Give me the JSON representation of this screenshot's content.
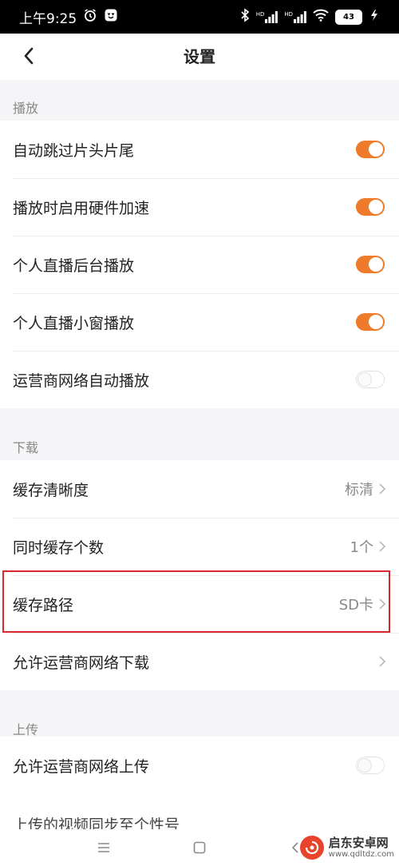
{
  "status_bar": {
    "time": "上午9:25",
    "network_1": "HD",
    "network_2": "HD",
    "battery": "43"
  },
  "header": {
    "title": "设置",
    "back_icon": "chevron-left-icon"
  },
  "sections": {
    "playback": {
      "title": "播放",
      "items": [
        {
          "label": "自动跳过片头片尾",
          "toggle": "on"
        },
        {
          "label": "播放时启用硬件加速",
          "toggle": "on"
        },
        {
          "label": "个人直播后台播放",
          "toggle": "on"
        },
        {
          "label": "个人直播小窗播放",
          "toggle": "on"
        },
        {
          "label": "运营商网络自动播放",
          "toggle": "off"
        }
      ]
    },
    "download": {
      "title": "下载",
      "items": [
        {
          "label": "缓存清晰度",
          "value": "标清"
        },
        {
          "label": "同时缓存个数",
          "value": "1个"
        },
        {
          "label": "缓存路径",
          "value": "SD卡"
        },
        {
          "label": "允许运营商网络下载",
          "value": ""
        }
      ]
    },
    "upload": {
      "title": "上传",
      "items": [
        {
          "label": "允许运营商网络上传",
          "toggle": "off"
        },
        {
          "label": "上传的视频同步至个性号"
        }
      ]
    }
  },
  "watermark": {
    "name": "启东安卓网",
    "url": "www.qdltdz.com"
  },
  "colors": {
    "accent": "#f07a2b",
    "highlight": "#d9282d"
  }
}
